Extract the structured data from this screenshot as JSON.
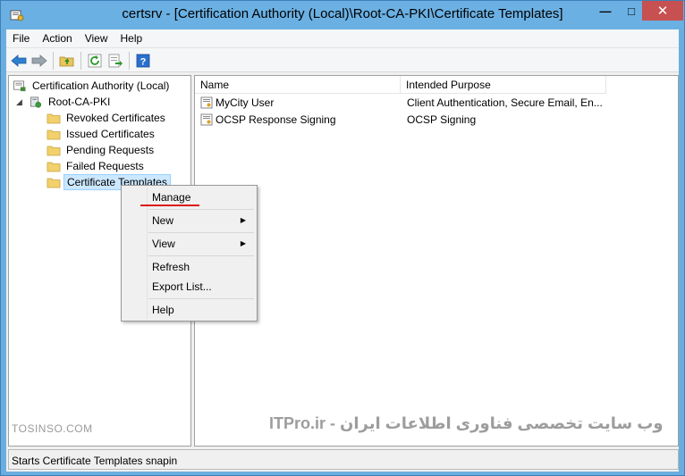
{
  "window": {
    "title": "certsrv - [Certification Authority (Local)\\Root-CA-PKI\\Certificate Templates]",
    "min_glyph": "—",
    "max_glyph": "□",
    "close_glyph": "✕"
  },
  "menubar": {
    "items": [
      "File",
      "Action",
      "View",
      "Help"
    ]
  },
  "toolbar": {
    "buttons": [
      "back-icon",
      "forward-icon",
      "up-folder-icon",
      "refresh-icon",
      "export-list-icon",
      "help-icon"
    ],
    "help_glyph": "?"
  },
  "tree": {
    "root": "Certification Authority (Local)",
    "ca": "Root-CA-PKI",
    "ca_expander": "◢",
    "children": [
      "Revoked Certificates",
      "Issued Certificates",
      "Pending Requests",
      "Failed Requests",
      "Certificate Templates"
    ],
    "selected": "Certificate Templates"
  },
  "list": {
    "columns": [
      "Name",
      "Intended Purpose"
    ],
    "rows": [
      {
        "name": "MyCity User",
        "purpose": "Client Authentication, Secure Email, En..."
      },
      {
        "name": "OCSP Response Signing",
        "purpose": "OCSP Signing"
      }
    ]
  },
  "context_menu": {
    "items": [
      "Manage",
      "New",
      "View",
      "Refresh",
      "Export List...",
      "Help"
    ],
    "submenu_arrow": "▶",
    "highlight_color": "#e01414"
  },
  "status": {
    "text": "Starts Certificate Templates snapin"
  },
  "watermarks": {
    "left": "TOSINSO.COM",
    "right": "ITPro.ir - وب سایت تخصصی فناوری اطلاعات ایران"
  },
  "colors": {
    "titlebar": "#6ab0e3",
    "close_button": "#c75050",
    "selection": "#cce8ff",
    "folder": "#f2d06b"
  }
}
